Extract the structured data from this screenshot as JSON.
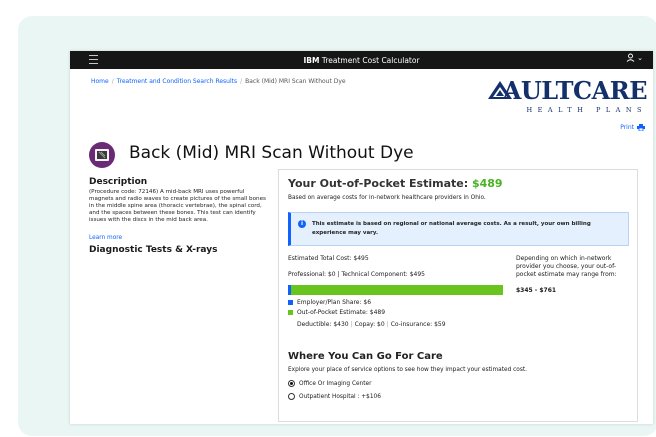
{
  "app": {
    "title_brand": "IBM",
    "title_rest": " Treatment Cost Calculator"
  },
  "breadcrumb": [
    "Home",
    "Treatment and Condition Search Results",
    "Back (Mid) MRI Scan Without Dye"
  ],
  "logo": {
    "word": "AULTCARE",
    "sub": "HEALTH PLANS"
  },
  "print_label": "Print",
  "page_title": "Back (Mid) MRI Scan Without Dye",
  "description": {
    "heading": "Description",
    "text": "(Procedure code: 72146) A mid-back MRI uses powerful magnets and radio waves to create pictures of the small bones in the middle spine area (thoracic vertebrae), the spinal cord, and the spaces between these bones. This test can identify issues with the discs in the mid back area.",
    "learn_more": "Learn more"
  },
  "diagnostic_heading": "Diagnostic Tests & X-rays",
  "estimate": {
    "title_prefix": "Your Out-of-Pocket Estimate: ",
    "amount": "$489",
    "subtitle": "Based on average costs for in-network healthcare providers in Ohio.",
    "notice": "This estimate is based on regional or national average costs. As a result, your own billing experience may vary.",
    "total": "Estimated Total Cost: $495",
    "professional": "Professional: $0",
    "technical": "Technical Component: $495",
    "bar": {
      "employer_share": 6,
      "out_of_pocket": 489,
      "total": 495
    },
    "legend_employer": "Employer/Plan Share: $6",
    "legend_oop": "Out-of-Pocket Estimate: $489",
    "deductible": "Deductible: $430",
    "copay": "Copay: $0",
    "coinsurance": "Co-insurance: $59",
    "range_text": "Depending on which in-network provider you choose, your out-of-pocket estimate may range from:",
    "range_value": "$345 - $761"
  },
  "where": {
    "heading": "Where You Can Go For Care",
    "subtitle": "Explore your place of service options to see how they impact your estimated cost.",
    "options": [
      {
        "label": "Office Or Imaging Center",
        "selected": true
      },
      {
        "label": "Outpatient Hospital : +$106",
        "selected": false
      }
    ]
  },
  "colors": {
    "topbar": "#161616",
    "brand_blue": "#0f62fe",
    "green": "#47b31f",
    "logo_navy": "#14306b"
  }
}
